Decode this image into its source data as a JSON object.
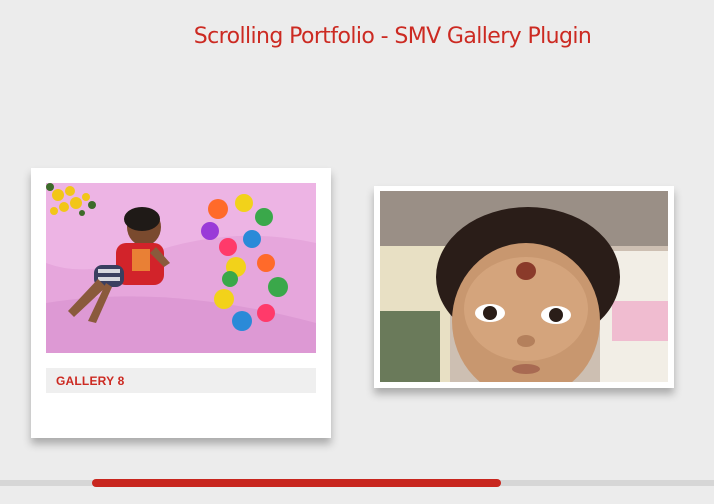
{
  "header": {
    "title": "Scrolling Portfolio - SMV Gallery Plugin"
  },
  "gallery": {
    "items": [
      {
        "caption": "GALLERY 8",
        "image": "baby-lying-on-pink-sheet-with-number-8-toys"
      },
      {
        "caption": "",
        "image": "baby-face-closeup-with-tilak"
      }
    ]
  },
  "scrollbar": {
    "progress": 0.13
  },
  "colors": {
    "accent": "#cc2a22",
    "background": "#ececec",
    "card": "#ffffff",
    "caption_bg": "#efefef"
  }
}
